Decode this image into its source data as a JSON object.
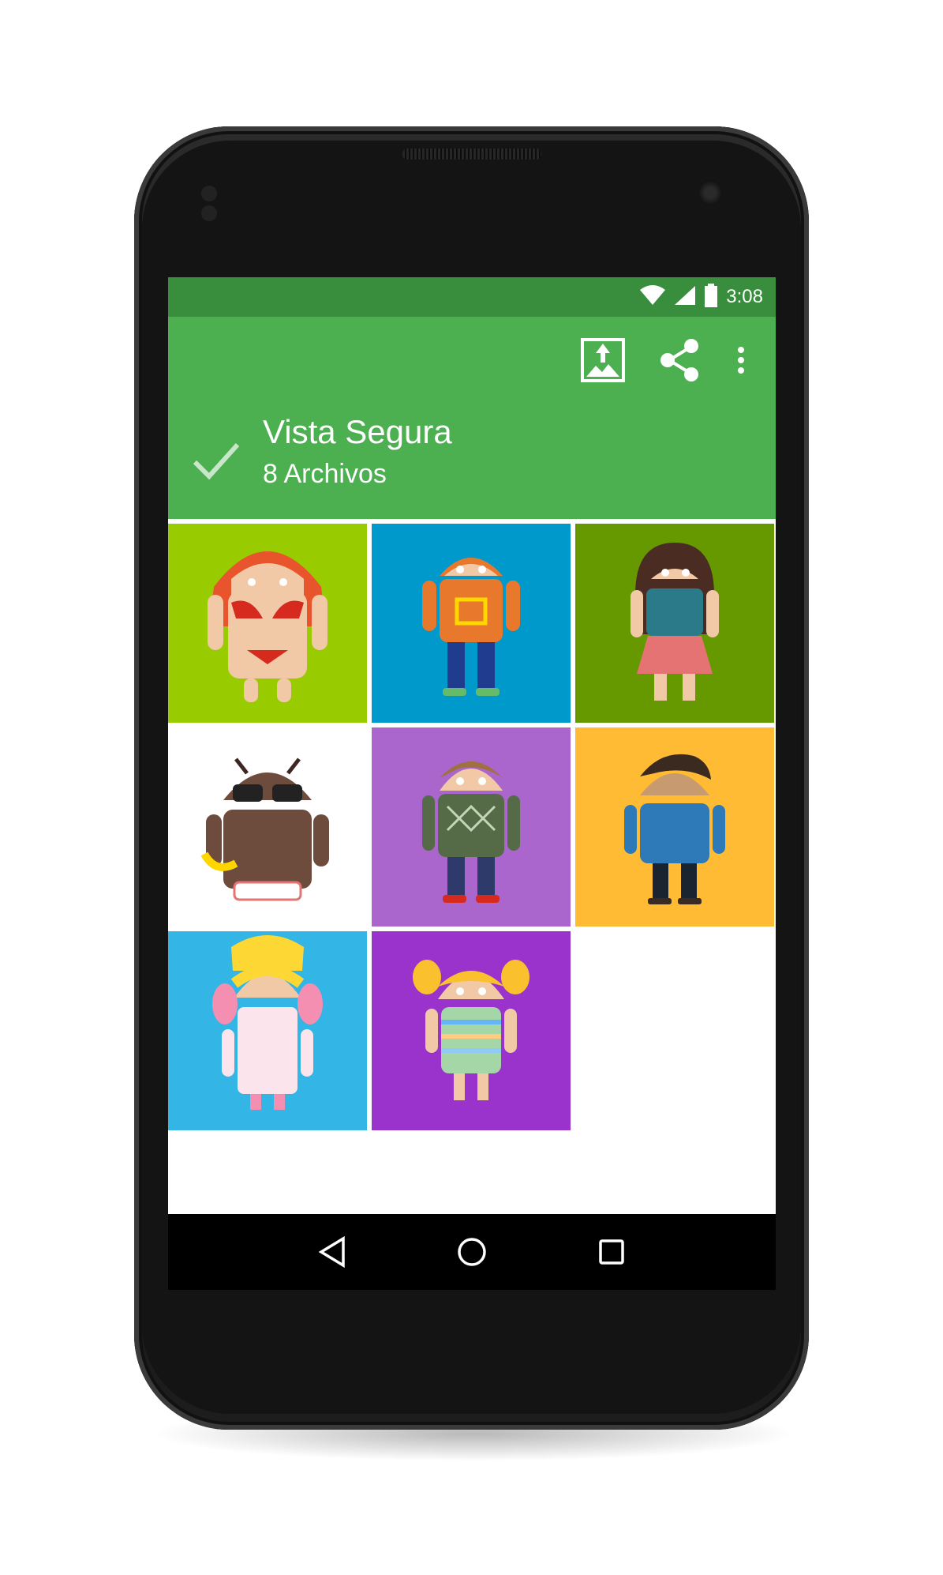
{
  "status_bar": {
    "time": "3:08",
    "icons": [
      "wifi-icon",
      "signal-icon",
      "battery-icon"
    ]
  },
  "app_bar": {
    "title": "Vista Segura",
    "subtitle": "8 Archivos",
    "actions": [
      "upload-image-icon",
      "share-icon",
      "more-vert-icon"
    ],
    "colors": {
      "status": "#388e3c",
      "toolbar": "#4caf50"
    }
  },
  "gallery": {
    "items": [
      {
        "name": "androidify-bikini",
        "bg": "#99cc00",
        "icon": "android-figure-icon"
      },
      {
        "name": "androidify-hoodie",
        "bg": "#0099cc",
        "icon": "android-figure-icon"
      },
      {
        "name": "androidify-girl-dress",
        "bg": "#669900",
        "icon": "android-figure-icon"
      },
      {
        "name": "androidify-sunglasses-banana",
        "bg": "#ffffff",
        "icon": "android-figure-icon"
      },
      {
        "name": "androidify-sweater",
        "bg": "#aa66cc",
        "icon": "android-figure-icon"
      },
      {
        "name": "androidify-polo",
        "bg": "#ffbb33",
        "icon": "android-figure-icon"
      },
      {
        "name": "androidify-earmuffs",
        "bg": "#33b5e5",
        "icon": "android-figure-icon"
      },
      {
        "name": "androidify-pigtails",
        "bg": "#9933cc",
        "icon": "android-figure-icon"
      }
    ]
  },
  "nav_bar": {
    "buttons": [
      "back-icon",
      "home-icon",
      "recents-icon"
    ]
  }
}
